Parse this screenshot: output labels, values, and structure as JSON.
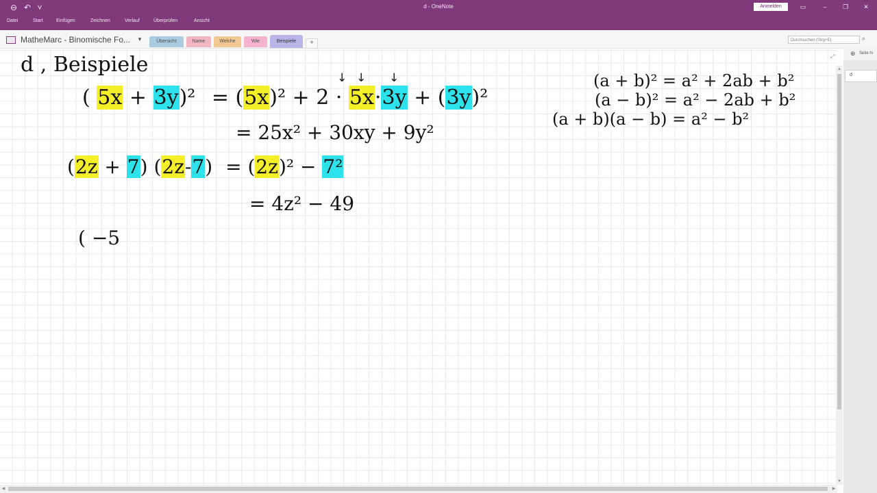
{
  "window": {
    "title": "d  -  OneNote",
    "signin_label": "Anmelden",
    "menu": [
      "Datei",
      "Start",
      "Einfügen",
      "Zeichnen",
      "Verlauf",
      "Überprüfen",
      "Ansicht"
    ]
  },
  "notebook": {
    "name": "MatheMarc - Binomische Fo...",
    "tabs": [
      {
        "label": "Übersicht",
        "color": "#a9cbe0"
      },
      {
        "label": "Name",
        "color": "#f2b6c2"
      },
      {
        "label": "Welche",
        "color": "#f1c891"
      },
      {
        "label": "Wie",
        "color": "#f5b3cf"
      },
      {
        "label": "Beispiele",
        "color": "#b9b5e8",
        "active": true
      }
    ],
    "add_tab_label": "+"
  },
  "search": {
    "placeholder": "Durchsuchen (Strg+E)"
  },
  "page_pane": {
    "add_page_label": "Seite hi",
    "pages": [
      "d"
    ]
  },
  "colors": {
    "accent": "#80397b",
    "highlight_yellow": "#f5ef2a",
    "highlight_cyan": "#2ee2eb"
  },
  "note": {
    "heading": "d ,  Beispiele",
    "ex1_left_open": "(",
    "ex1_a": "5x",
    "ex1_plus": "+",
    "ex1_b": "3y",
    "ex1_close": ")²",
    "ex1_eq": "=",
    "ex1_rhs_open": "(",
    "ex1_rhs_a": "5x",
    "ex1_rhs_close": ")²  +  2 ·",
    "ex1_rhs_a2": "5x",
    "ex1_dot": "·",
    "ex1_rhs_b": "3y",
    "ex1_rhs_plus": "+  (",
    "ex1_rhs_b2": "3y",
    "ex1_rhs_end": ")²",
    "ex1_result": "= 25x²  +  30xy     +  9y²",
    "ex2_open": "(",
    "ex2_a": "2z",
    "ex2_plus": "+",
    "ex2_b": "7",
    "ex2_mid": ") (",
    "ex2_a2": "2z",
    "ex2_minus": "-",
    "ex2_b2": "7",
    "ex2_close": ")",
    "ex2_eq": "=  (",
    "ex2_rhs_a": "2z",
    "ex2_rhs_close": ")²   −",
    "ex2_rhs_b": "7²",
    "ex2_result": "= 4z²    − 49",
    "ex3": "( −5",
    "formula1": "(a + b)² = a² + 2ab + b²",
    "formula2": "(a − b)² = a² − 2ab + b²",
    "formula3": "(a + b)(a − b) = a² − b²",
    "arrows": [
      "↓",
      "↓",
      "↓"
    ]
  }
}
